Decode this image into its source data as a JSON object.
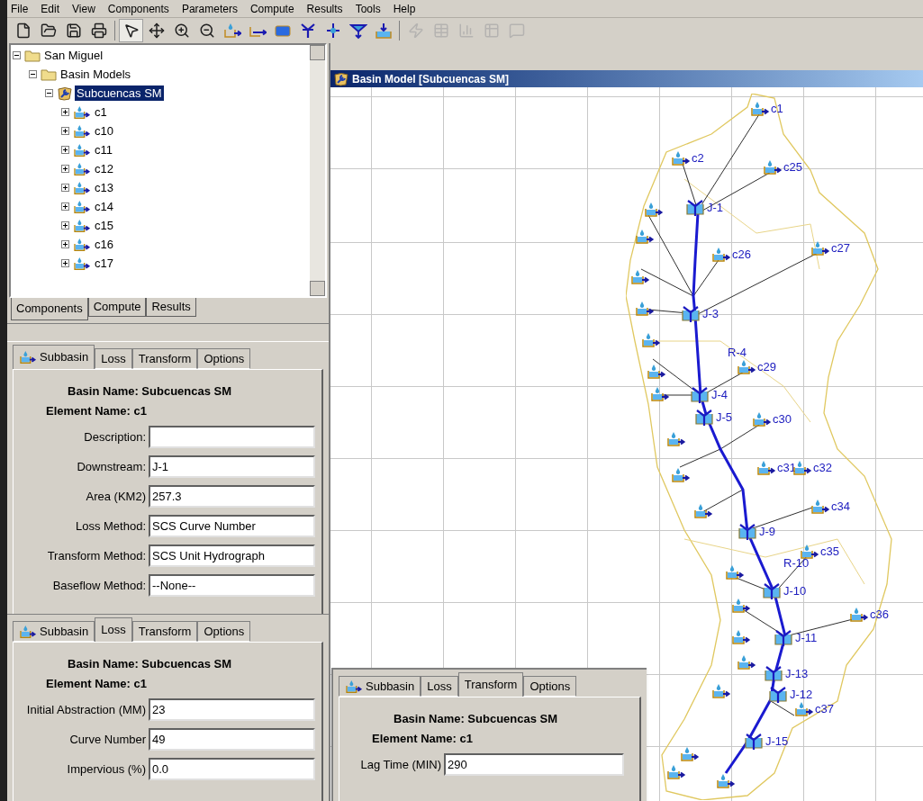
{
  "menu": [
    "File",
    "Edit",
    "View",
    "Components",
    "Parameters",
    "Compute",
    "Results",
    "Tools",
    "Help"
  ],
  "toolbar": [
    {
      "kind": "new",
      "selected": false,
      "disabled": false
    },
    {
      "kind": "open",
      "selected": false,
      "disabled": false
    },
    {
      "kind": "save",
      "selected": false,
      "disabled": false
    },
    {
      "kind": "print",
      "selected": false,
      "disabled": false
    },
    {
      "kind": "pointer",
      "selected": true,
      "disabled": false
    },
    {
      "kind": "move",
      "selected": false,
      "disabled": false
    },
    {
      "kind": "zoom-in",
      "selected": false,
      "disabled": false
    },
    {
      "kind": "zoom-out",
      "selected": false,
      "disabled": false
    },
    {
      "kind": "subbasin",
      "selected": false,
      "disabled": false
    },
    {
      "kind": "reach",
      "selected": false,
      "disabled": false
    },
    {
      "kind": "reservoir",
      "selected": false,
      "disabled": false
    },
    {
      "kind": "junction",
      "selected": false,
      "disabled": false
    },
    {
      "kind": "diversion",
      "selected": false,
      "disabled": false
    },
    {
      "kind": "source",
      "selected": false,
      "disabled": false
    },
    {
      "kind": "sink",
      "selected": false,
      "disabled": false
    },
    {
      "kind": "compute",
      "selected": false,
      "disabled": true
    },
    {
      "kind": "table",
      "selected": false,
      "disabled": true
    },
    {
      "kind": "graph",
      "selected": false,
      "disabled": true
    },
    {
      "kind": "grid",
      "selected": false,
      "disabled": true
    },
    {
      "kind": "message",
      "selected": false,
      "disabled": true
    }
  ],
  "tree": [
    {
      "label": "San Miguel",
      "kind": "folder",
      "expanded": true,
      "selected": false,
      "children": [
        {
          "label": "Basin Models",
          "kind": "folder",
          "expanded": true,
          "selected": false,
          "children": [
            {
              "label": "Subcuencas SM",
              "kind": "basin",
              "expanded": true,
              "selected": true,
              "children": [
                {
                  "label": "c1",
                  "kind": "subbasin",
                  "expanded": false,
                  "selected": false
                },
                {
                  "label": "c10",
                  "kind": "subbasin",
                  "expanded": false,
                  "selected": false
                },
                {
                  "label": "c11",
                  "kind": "subbasin",
                  "expanded": false,
                  "selected": false
                },
                {
                  "label": "c12",
                  "kind": "subbasin",
                  "expanded": false,
                  "selected": false
                },
                {
                  "label": "c13",
                  "kind": "subbasin",
                  "expanded": false,
                  "selected": false
                },
                {
                  "label": "c14",
                  "kind": "subbasin",
                  "expanded": false,
                  "selected": false
                },
                {
                  "label": "c15",
                  "kind": "subbasin",
                  "expanded": false,
                  "selected": false
                },
                {
                  "label": "c16",
                  "kind": "subbasin",
                  "expanded": false,
                  "selected": false
                },
                {
                  "label": "c17",
                  "kind": "subbasin",
                  "expanded": false,
                  "selected": false
                }
              ]
            }
          ]
        }
      ]
    }
  ],
  "explorer_tabs": [
    {
      "label": "Components",
      "selected": true
    },
    {
      "label": "Compute",
      "selected": false
    },
    {
      "label": "Results",
      "selected": false
    }
  ],
  "panels": [
    {
      "tabs": [
        {
          "label": "Subbasin",
          "selected": true
        },
        {
          "label": "Loss",
          "selected": false
        },
        {
          "label": "Transform",
          "selected": false
        },
        {
          "label": "Options",
          "selected": false
        }
      ],
      "basin_name": "Basin Name: Subcuencas SM",
      "element_name": "Element Name: c1",
      "fields": [
        {
          "label": "Description:"
        },
        {
          "label": "Downstream:",
          "value": "J-1"
        },
        {
          "label": "Area (KM2)",
          "value": "257.3"
        },
        {
          "label": "Loss Method:",
          "value": "SCS Curve Number"
        },
        {
          "label": "Transform Method:",
          "value": "SCS Unit Hydrograph"
        },
        {
          "label": "Baseflow Method:",
          "value": "--None--"
        }
      ]
    },
    {
      "tabs": [
        {
          "label": "Subbasin",
          "selected": false
        },
        {
          "label": "Loss",
          "selected": true
        },
        {
          "label": "Transform",
          "selected": false
        },
        {
          "label": "Options",
          "selected": false
        }
      ],
      "basin_name": "Basin Name: Subcuencas SM",
      "element_name": "Element Name: c1",
      "fields": [
        {
          "label": "Initial Abstraction (MM)",
          "value": "23"
        },
        {
          "label": "Curve Number",
          "value": "49"
        },
        {
          "label": "Impervious (%)",
          "value": "0.0"
        }
      ]
    },
    {
      "tabs": [
        {
          "label": "Subbasin",
          "selected": false
        },
        {
          "label": "Loss",
          "selected": false
        },
        {
          "label": "Transform",
          "selected": true
        },
        {
          "label": "Options",
          "selected": false
        }
      ],
      "basin_name": "Basin Name: Subcuencas SM",
      "element_name": "Element Name: c1",
      "fields": [
        {
          "label": "Lag Time (MIN)",
          "value": "290"
        }
      ]
    }
  ],
  "map": {
    "title": "Basin Model [Subcuencas SM]",
    "nodes": [
      {
        "label": "c1",
        "kind": "subbasin"
      },
      {
        "label": "c2",
        "kind": "subbasin"
      },
      {
        "label": "c25",
        "kind": "subbasin"
      },
      {
        "label": "J-1",
        "kind": "junction"
      },
      {
        "label": "c26",
        "kind": "subbasin"
      },
      {
        "label": "c27",
        "kind": "subbasin"
      },
      {
        "label": "J-3",
        "kind": "junction"
      },
      {
        "label": "R-4",
        "kind": "reach"
      },
      {
        "label": "c29",
        "kind": "subbasin"
      },
      {
        "label": "J-4",
        "kind": "junction"
      },
      {
        "label": "J-5",
        "kind": "junction"
      },
      {
        "label": "c30",
        "kind": "subbasin"
      },
      {
        "label": "c31",
        "kind": "subbasin"
      },
      {
        "label": "c32",
        "kind": "subbasin"
      },
      {
        "label": "c34",
        "kind": "subbasin"
      },
      {
        "label": "J-9",
        "kind": "junction"
      },
      {
        "label": "c35",
        "kind": "subbasin"
      },
      {
        "label": "R-10",
        "kind": "reach"
      },
      {
        "label": "J-10",
        "kind": "junction"
      },
      {
        "label": "c36",
        "kind": "subbasin"
      },
      {
        "label": "J-11",
        "kind": "junction"
      },
      {
        "label": "J-13",
        "kind": "junction"
      },
      {
        "label": "J-12",
        "kind": "junction"
      },
      {
        "label": "c37",
        "kind": "subbasin"
      },
      {
        "label": "J-15",
        "kind": "junction"
      }
    ]
  }
}
